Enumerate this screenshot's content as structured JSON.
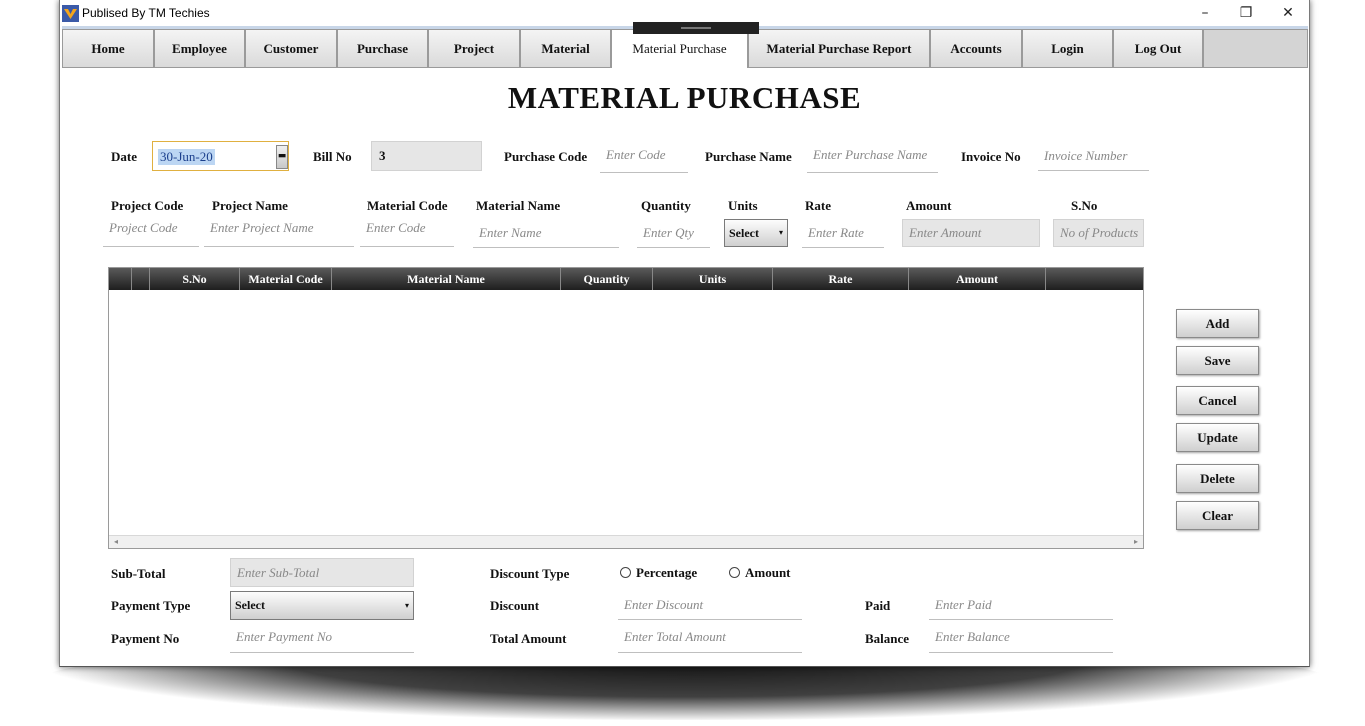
{
  "window": {
    "title": "Publised By TM Techies"
  },
  "titlebar": {
    "minimize": "–",
    "restore": "❐",
    "close": "✕"
  },
  "tabs": [
    "Home",
    "Employee",
    "Customer",
    "Purchase",
    "Project",
    "Material",
    "Material Purchase",
    "Material Purchase Report",
    "Accounts",
    "Login",
    "Log Out"
  ],
  "active_tab": "Material Purchase",
  "page_title": "MATERIAL PURCHASE",
  "header_form": {
    "date_label": "Date",
    "date_value": "30-Jun-20",
    "bill_no_label": "Bill No",
    "bill_no_value": "3",
    "purchase_code_label": "Purchase Code",
    "purchase_code_placeholder": "Enter Code",
    "purchase_name_label": "Purchase Name",
    "purchase_name_placeholder": "Enter Purchase Name",
    "invoice_no_label": "Invoice No",
    "invoice_no_placeholder": "Invoice Number"
  },
  "item_form": {
    "project_code_label": "Project Code",
    "project_code_placeholder": "Project Code",
    "project_name_label": "Project Name",
    "project_name_placeholder": "Enter Project Name",
    "material_code_label": "Material Code",
    "material_code_placeholder": "Enter Code",
    "material_name_label": "Material Name",
    "material_name_placeholder": "Enter Name",
    "quantity_label": "Quantity",
    "quantity_placeholder": "Enter Qty",
    "units_label": "Units",
    "units_value": "Select",
    "rate_label": "Rate",
    "rate_placeholder": "Enter Rate",
    "amount_label": "Amount",
    "amount_placeholder": "Enter Amount",
    "sno_label": "S.No",
    "sno_placeholder": "No of Products"
  },
  "grid": {
    "columns": [
      "S.No",
      "Material Code",
      "Material Name",
      "Quantity",
      "Units",
      "Rate",
      "Amount"
    ],
    "rows": []
  },
  "actions": [
    "Add",
    "Save",
    "Cancel",
    "Update",
    "Delete",
    "Clear"
  ],
  "footer": {
    "subtotal_label": "Sub-Total",
    "subtotal_placeholder": "Enter Sub-Total",
    "payment_type_label": "Payment Type",
    "payment_type_value": "Select",
    "payment_no_label": "Payment No",
    "payment_no_placeholder": "Enter Payment No",
    "discount_type_label": "Discount Type",
    "discount_type_options": [
      "Percentage",
      "Amount"
    ],
    "discount_label": "Discount",
    "discount_placeholder": "Enter Discount",
    "total_amount_label": "Total Amount",
    "total_amount_placeholder": "Enter Total Amount",
    "paid_label": "Paid",
    "paid_placeholder": "Enter Paid",
    "balance_label": "Balance",
    "balance_placeholder": "Enter Balance"
  }
}
